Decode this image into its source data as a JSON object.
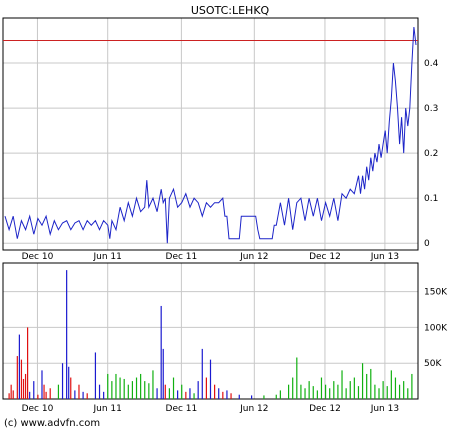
{
  "title": "USOTC:LEHKQ",
  "copyright": "(c) www.advfn.com",
  "colors": {
    "price_line": "#1c24c8",
    "reference_line": "#cc2222",
    "volume_blue": "#1a1ad0",
    "volume_red": "#e01010",
    "volume_green": "#10b010",
    "grid": "#c8c8c8",
    "border": "#000000"
  },
  "chart_data": [
    {
      "type": "line",
      "panel": "price",
      "x_tick_labels": [
        "Dec 10",
        "Jun 11",
        "Dec 11",
        "Jun 12",
        "Dec 12",
        "Jun 13"
      ],
      "y_ticks": [
        0,
        0.1,
        0.2,
        0.3,
        0.4
      ],
      "y_tick_labels": [
        "0",
        "0.1",
        "0.2",
        "0.3",
        "0.4"
      ],
      "ylim": [
        -0.015,
        0.5
      ],
      "reference_value": 0.45,
      "grid": true,
      "price_points": [
        [
          0,
          0.06
        ],
        [
          0.01,
          0.03
        ],
        [
          0.02,
          0.06
        ],
        [
          0.03,
          0.01
        ],
        [
          0.04,
          0.05
        ],
        [
          0.05,
          0.03
        ],
        [
          0.06,
          0.06
        ],
        [
          0.07,
          0.02
        ],
        [
          0.08,
          0.055
        ],
        [
          0.09,
          0.04
        ],
        [
          0.1,
          0.06
        ],
        [
          0.11,
          0.02
        ],
        [
          0.12,
          0.05
        ],
        [
          0.13,
          0.03
        ],
        [
          0.14,
          0.045
        ],
        [
          0.15,
          0.05
        ],
        [
          0.16,
          0.03
        ],
        [
          0.17,
          0.045
        ],
        [
          0.18,
          0.05
        ],
        [
          0.19,
          0.03
        ],
        [
          0.2,
          0.05
        ],
        [
          0.21,
          0.04
        ],
        [
          0.22,
          0.05
        ],
        [
          0.23,
          0.03
        ],
        [
          0.24,
          0.05
        ],
        [
          0.25,
          0.04
        ],
        [
          0.255,
          0.01
        ],
        [
          0.26,
          0.05
        ],
        [
          0.27,
          0.03
        ],
        [
          0.28,
          0.08
        ],
        [
          0.29,
          0.05
        ],
        [
          0.3,
          0.09
        ],
        [
          0.31,
          0.06
        ],
        [
          0.32,
          0.1
        ],
        [
          0.33,
          0.07
        ],
        [
          0.34,
          0.08
        ],
        [
          0.345,
          0.14
        ],
        [
          0.35,
          0.08
        ],
        [
          0.36,
          0.1
        ],
        [
          0.37,
          0.07
        ],
        [
          0.38,
          0.12
        ],
        [
          0.385,
          0.09
        ],
        [
          0.39,
          0.1
        ],
        [
          0.395,
          0.0
        ],
        [
          0.4,
          0.1
        ],
        [
          0.41,
          0.12
        ],
        [
          0.42,
          0.08
        ],
        [
          0.43,
          0.09
        ],
        [
          0.44,
          0.11
        ],
        [
          0.45,
          0.08
        ],
        [
          0.46,
          0.1
        ],
        [
          0.47,
          0.09
        ],
        [
          0.48,
          0.06
        ],
        [
          0.49,
          0.09
        ],
        [
          0.5,
          0.08
        ],
        [
          0.51,
          0.09
        ],
        [
          0.52,
          0.09
        ],
        [
          0.53,
          0.1
        ],
        [
          0.535,
          0.06
        ],
        [
          0.54,
          0.06
        ],
        [
          0.545,
          0.01
        ],
        [
          0.57,
          0.01
        ],
        [
          0.575,
          0.06
        ],
        [
          0.61,
          0.06
        ],
        [
          0.615,
          0.03
        ],
        [
          0.62,
          0.01
        ],
        [
          0.65,
          0.01
        ],
        [
          0.655,
          0.04
        ],
        [
          0.66,
          0.04
        ],
        [
          0.67,
          0.09
        ],
        [
          0.68,
          0.04
        ],
        [
          0.69,
          0.1
        ],
        [
          0.7,
          0.03
        ],
        [
          0.71,
          0.09
        ],
        [
          0.72,
          0.1
        ],
        [
          0.73,
          0.05
        ],
        [
          0.74,
          0.1
        ],
        [
          0.75,
          0.06
        ],
        [
          0.76,
          0.1
        ],
        [
          0.77,
          0.05
        ],
        [
          0.78,
          0.09
        ],
        [
          0.79,
          0.06
        ],
        [
          0.8,
          0.1
        ],
        [
          0.81,
          0.05
        ],
        [
          0.82,
          0.11
        ],
        [
          0.83,
          0.1
        ],
        [
          0.84,
          0.12
        ],
        [
          0.85,
          0.11
        ],
        [
          0.86,
          0.15
        ],
        [
          0.865,
          0.11
        ],
        [
          0.87,
          0.15
        ],
        [
          0.875,
          0.12
        ],
        [
          0.88,
          0.17
        ],
        [
          0.885,
          0.14
        ],
        [
          0.89,
          0.19
        ],
        [
          0.895,
          0.16
        ],
        [
          0.9,
          0.2
        ],
        [
          0.905,
          0.18
        ],
        [
          0.91,
          0.22
        ],
        [
          0.915,
          0.19
        ],
        [
          0.92,
          0.22
        ],
        [
          0.925,
          0.25
        ],
        [
          0.93,
          0.2
        ],
        [
          0.935,
          0.27
        ],
        [
          0.94,
          0.32
        ],
        [
          0.945,
          0.4
        ],
        [
          0.95,
          0.36
        ],
        [
          0.955,
          0.3
        ],
        [
          0.96,
          0.22
        ],
        [
          0.965,
          0.28
        ],
        [
          0.97,
          0.2
        ],
        [
          0.975,
          0.3
        ],
        [
          0.98,
          0.26
        ],
        [
          0.985,
          0.3
        ],
        [
          0.99,
          0.4
        ],
        [
          0.995,
          0.48
        ],
        [
          1.0,
          0.44
        ]
      ]
    },
    {
      "type": "bar",
      "panel": "volume",
      "x_tick_labels": [
        "Dec 10",
        "Jun 11",
        "Dec 11",
        "Jun 12",
        "Dec 12",
        "Jun 13"
      ],
      "y_ticks": [
        50000,
        100000,
        150000
      ],
      "y_tick_labels": [
        "50K",
        "100K",
        "150K"
      ],
      "ylim": [
        0,
        190000
      ],
      "grid": true,
      "volume_bars": [
        [
          0.01,
          8000,
          "red"
        ],
        [
          0.015,
          20000,
          "red"
        ],
        [
          0.02,
          12000,
          "red"
        ],
        [
          0.03,
          60000,
          "red"
        ],
        [
          0.035,
          90000,
          "blue"
        ],
        [
          0.04,
          55000,
          "red"
        ],
        [
          0.045,
          28000,
          "red"
        ],
        [
          0.05,
          35000,
          "red"
        ],
        [
          0.055,
          100000,
          "red"
        ],
        [
          0.06,
          10000,
          "blue"
        ],
        [
          0.07,
          25000,
          "blue"
        ],
        [
          0.08,
          6000,
          "red"
        ],
        [
          0.09,
          40000,
          "blue"
        ],
        [
          0.095,
          20000,
          "red"
        ],
        [
          0.1,
          10000,
          "red"
        ],
        [
          0.11,
          15000,
          "red"
        ],
        [
          0.13,
          20000,
          "green"
        ],
        [
          0.14,
          50000,
          "blue"
        ],
        [
          0.15,
          180000,
          "blue"
        ],
        [
          0.155,
          45000,
          "blue"
        ],
        [
          0.16,
          30000,
          "red"
        ],
        [
          0.17,
          12000,
          "blue"
        ],
        [
          0.18,
          20000,
          "red"
        ],
        [
          0.19,
          10000,
          "blue"
        ],
        [
          0.2,
          8000,
          "red"
        ],
        [
          0.22,
          65000,
          "blue"
        ],
        [
          0.23,
          20000,
          "blue"
        ],
        [
          0.24,
          10000,
          "blue"
        ],
        [
          0.25,
          35000,
          "green"
        ],
        [
          0.26,
          25000,
          "green"
        ],
        [
          0.27,
          35000,
          "green"
        ],
        [
          0.28,
          30000,
          "green"
        ],
        [
          0.29,
          28000,
          "green"
        ],
        [
          0.3,
          20000,
          "green"
        ],
        [
          0.31,
          25000,
          "green"
        ],
        [
          0.32,
          30000,
          "green"
        ],
        [
          0.33,
          35000,
          "green"
        ],
        [
          0.34,
          25000,
          "green"
        ],
        [
          0.35,
          22000,
          "green"
        ],
        [
          0.36,
          40000,
          "green"
        ],
        [
          0.37,
          15000,
          "blue"
        ],
        [
          0.38,
          130000,
          "blue"
        ],
        [
          0.385,
          70000,
          "blue"
        ],
        [
          0.39,
          20000,
          "red"
        ],
        [
          0.4,
          15000,
          "green"
        ],
        [
          0.41,
          30000,
          "green"
        ],
        [
          0.42,
          12000,
          "blue"
        ],
        [
          0.43,
          20000,
          "green"
        ],
        [
          0.44,
          10000,
          "red"
        ],
        [
          0.45,
          15000,
          "blue"
        ],
        [
          0.46,
          8000,
          "green"
        ],
        [
          0.47,
          25000,
          "blue"
        ],
        [
          0.48,
          70000,
          "blue"
        ],
        [
          0.49,
          30000,
          "red"
        ],
        [
          0.5,
          55000,
          "blue"
        ],
        [
          0.51,
          20000,
          "red"
        ],
        [
          0.52,
          15000,
          "blue"
        ],
        [
          0.53,
          10000,
          "red"
        ],
        [
          0.54,
          12000,
          "blue"
        ],
        [
          0.55,
          8000,
          "red"
        ],
        [
          0.57,
          6000,
          "blue"
        ],
        [
          0.6,
          5000,
          "blue"
        ],
        [
          0.63,
          5000,
          "green"
        ],
        [
          0.66,
          6000,
          "green"
        ],
        [
          0.67,
          12000,
          "green"
        ],
        [
          0.69,
          20000,
          "green"
        ],
        [
          0.7,
          30000,
          "green"
        ],
        [
          0.71,
          58000,
          "green"
        ],
        [
          0.72,
          20000,
          "green"
        ],
        [
          0.73,
          15000,
          "green"
        ],
        [
          0.74,
          25000,
          "green"
        ],
        [
          0.75,
          18000,
          "green"
        ],
        [
          0.76,
          12000,
          "green"
        ],
        [
          0.77,
          30000,
          "green"
        ],
        [
          0.78,
          20000,
          "green"
        ],
        [
          0.79,
          15000,
          "green"
        ],
        [
          0.8,
          25000,
          "green"
        ],
        [
          0.81,
          20000,
          "green"
        ],
        [
          0.82,
          40000,
          "green"
        ],
        [
          0.83,
          15000,
          "green"
        ],
        [
          0.84,
          25000,
          "green"
        ],
        [
          0.85,
          30000,
          "green"
        ],
        [
          0.86,
          18000,
          "green"
        ],
        [
          0.87,
          50000,
          "green"
        ],
        [
          0.88,
          35000,
          "green"
        ],
        [
          0.89,
          42000,
          "green"
        ],
        [
          0.9,
          20000,
          "green"
        ],
        [
          0.91,
          15000,
          "green"
        ],
        [
          0.92,
          25000,
          "green"
        ],
        [
          0.93,
          18000,
          "green"
        ],
        [
          0.94,
          40000,
          "green"
        ],
        [
          0.95,
          30000,
          "green"
        ],
        [
          0.96,
          20000,
          "green"
        ],
        [
          0.97,
          25000,
          "green"
        ],
        [
          0.98,
          15000,
          "green"
        ],
        [
          0.99,
          35000,
          "green"
        ]
      ]
    }
  ]
}
